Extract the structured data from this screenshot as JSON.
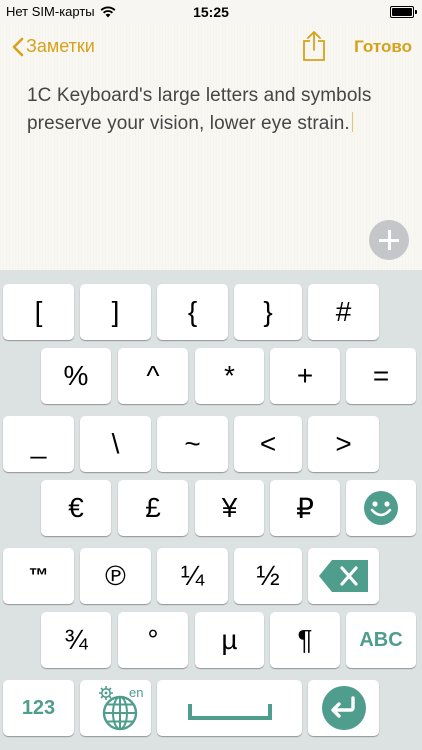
{
  "status_bar": {
    "carrier": "Нет SIM-карты",
    "time": "15:25"
  },
  "nav": {
    "back_label": "Заметки",
    "done_label": "Готово"
  },
  "note": {
    "text": "1C Keyboard's large letters and symbols preserve your vision, lower eye strain."
  },
  "keyboard": {
    "rows": [
      [
        "[",
        "]",
        "{",
        "}",
        "#"
      ],
      [
        "%",
        "^",
        "*",
        "+",
        "="
      ],
      [
        "_",
        "\\",
        "~",
        "<",
        ">"
      ],
      [
        "€",
        "£",
        "¥",
        "₽",
        "smile"
      ],
      [
        "™",
        "℗",
        "¼",
        "½",
        "backspace"
      ],
      [
        "¾",
        "°",
        "µ",
        "¶",
        "ABC"
      ]
    ],
    "bottom_row": {
      "numbers_label": "123",
      "language_label": "en"
    }
  },
  "colors": {
    "accent": "#d6a21c",
    "key_accent": "#4f9d8c",
    "keyboard_bg": "#dce1e1"
  }
}
